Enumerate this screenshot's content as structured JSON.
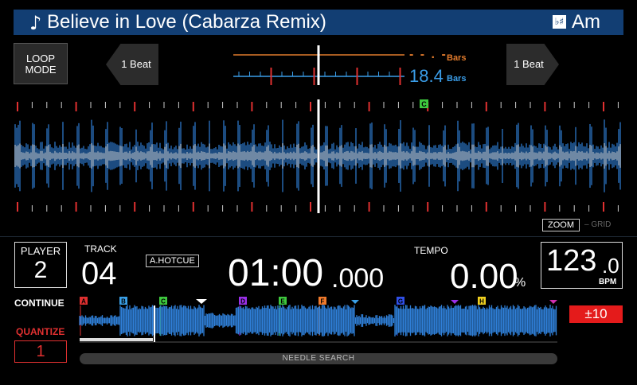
{
  "title_bar": {
    "note_icon": "music-note-icon",
    "track_title": "Believe in Love (Cabarza Remix)",
    "key_icon": "key-icon",
    "key_icon_glyph": "♭♯",
    "key": "Am"
  },
  "loop_mode": {
    "label": "LOOP\nMODE"
  },
  "beat_jump": {
    "left_label": "1 Beat",
    "right_label": "1 Beat"
  },
  "bars": {
    "top_value": "- - . -",
    "top_unit": "Bars",
    "bottom_value": "18.4",
    "bottom_unit": "Bars"
  },
  "zoom": {
    "zoom_label": "ZOOM",
    "grid_label": "GRID"
  },
  "player": {
    "label": "PLAYER",
    "number": "2"
  },
  "track": {
    "label": "TRACK",
    "number": "04"
  },
  "hotcue_mode": "A.HOTCUE",
  "time": {
    "main": "01:00",
    "ms": ".000"
  },
  "tempo": {
    "label": "TEMPO",
    "value": "0.00",
    "unit": "%"
  },
  "bpm": {
    "value": "123",
    "decimal": ".0",
    "unit": "BPM"
  },
  "continue_label": "CONTINUE",
  "quantize": {
    "label": "QUANTIZE",
    "value": "1"
  },
  "tempo_range": "±10",
  "needle_search": "NEEDLE SEARCH",
  "hot_cues": [
    {
      "letter": "A",
      "color": "#e03030"
    },
    {
      "letter": "B",
      "color": "#3aa0e8"
    },
    {
      "letter": "C",
      "color": "#3ec83e"
    },
    {
      "letter": "D",
      "color": "#9a30e8"
    },
    {
      "letter": "E",
      "color": "#3ec83e"
    },
    {
      "letter": "F",
      "color": "#f07a2c"
    },
    {
      "letter": "G",
      "color": "#3050e8"
    },
    {
      "letter": "H",
      "color": "#f0d020"
    }
  ],
  "colors": {
    "title_bg": "#123e73",
    "waveform": "#3a88e0",
    "accent_orange": "#e07a2c",
    "accent_blue": "#3a9de8",
    "alert_red": "#e41b1b"
  }
}
